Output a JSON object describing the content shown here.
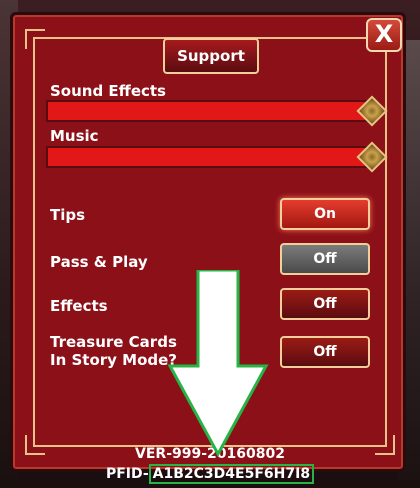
{
  "settings": {
    "support_label": "Support",
    "close_label": "X",
    "sound_effects_label": "Sound Effects",
    "music_label": "Music",
    "tips_label": "Tips",
    "tips_value": "On",
    "pass_play_label": "Pass & Play",
    "pass_play_value": "Off",
    "effects_label": "Effects",
    "effects_value": "Off",
    "treasure_label_line1": "Treasure Cards",
    "treasure_label_line2": "In Story Mode?",
    "treasure_value": "Off"
  },
  "footer": {
    "version": "VER-999-20160802",
    "pfid_prefix": "PFID-",
    "pfid": "A1B2C3D4E5F6H7I8"
  },
  "colors": {
    "panel": "#8c1018",
    "gold": "#e7c38a",
    "slider": "#e21818",
    "highlight": "#27b447"
  }
}
